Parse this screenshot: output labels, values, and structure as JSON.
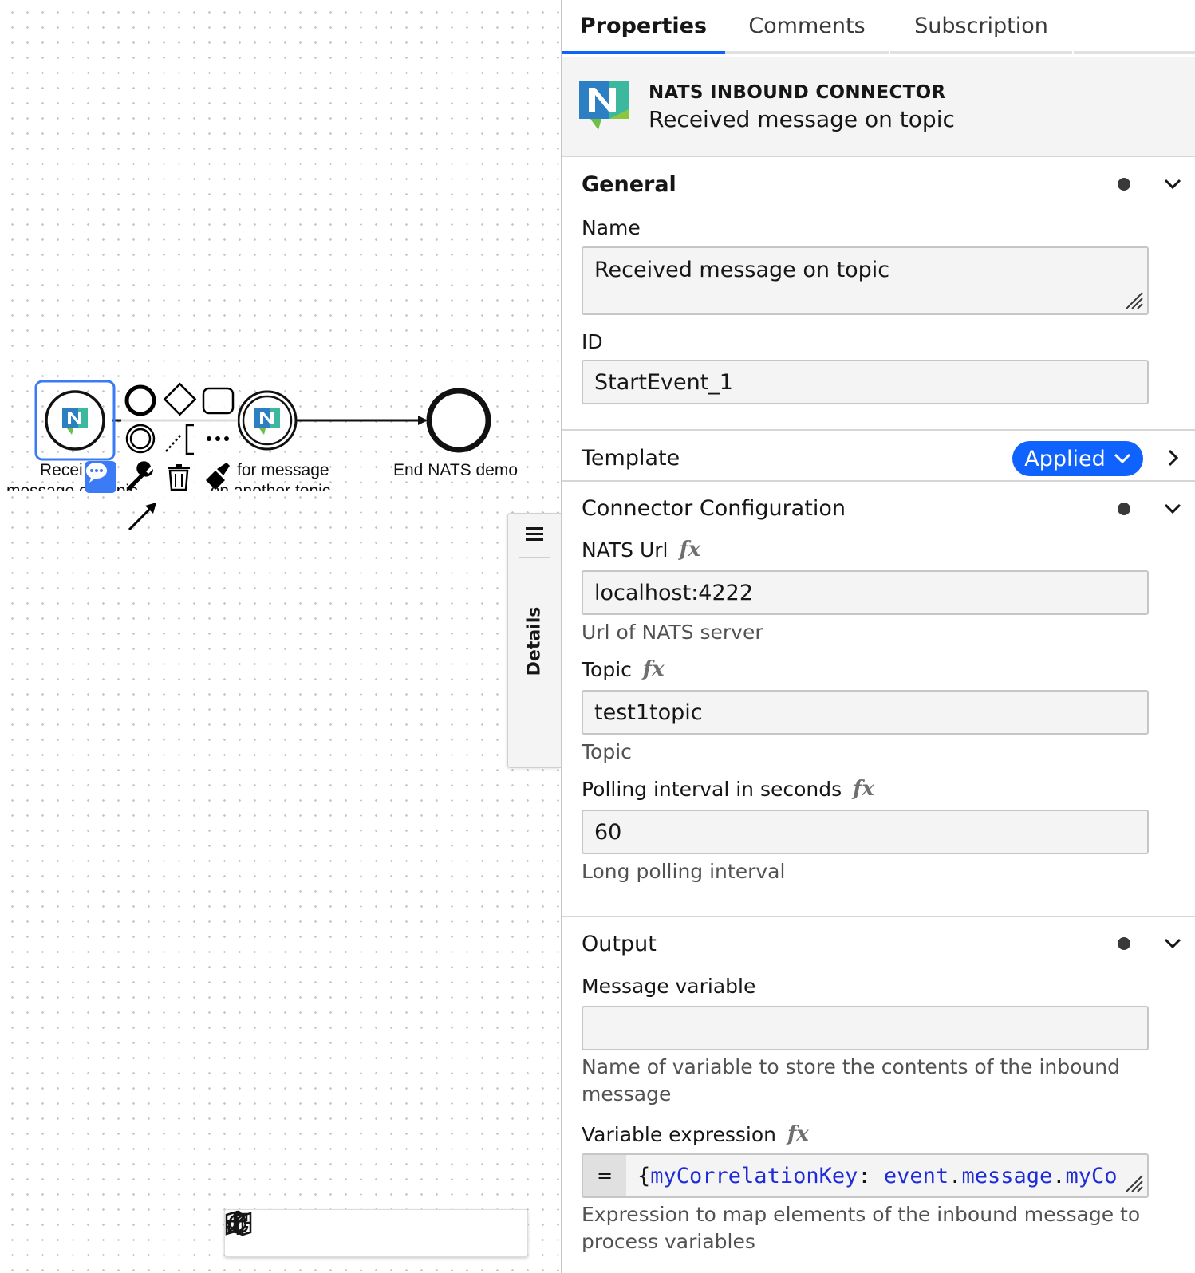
{
  "canvas": {
    "nodes": {
      "start_label_line1": "Recei",
      "start_label_line2": "message on topic",
      "intermediate_label_line1": "for message",
      "intermediate_label_line2": "on another topic",
      "end_label": "End NATS demo"
    },
    "context_pad_icons": [
      "end-event-icon",
      "gateway-icon",
      "task-icon",
      "intermediate-event-icon",
      "association-icon",
      "text-annotation-icon",
      "more-icon",
      "comment-icon",
      "wrench-icon",
      "trash-icon",
      "color-icon",
      "connect-icon"
    ],
    "details_tab": {
      "label": "Details"
    },
    "toolbar_icons": [
      "reset-position-icon",
      "fullscreen-icon",
      "minimap-icon",
      "recenter-icon",
      "zoom-out-icon",
      "zoom-in-icon"
    ]
  },
  "panel": {
    "tabs": [
      {
        "label": "Properties",
        "active": true
      },
      {
        "label": "Comments",
        "active": false
      },
      {
        "label": "Subscription",
        "active": false
      }
    ],
    "header": {
      "type": "NATS INBOUND CONNECTOR",
      "name": "Received message on topic"
    },
    "general": {
      "title": "General",
      "name_label": "Name",
      "name_value": "Received message on topic",
      "id_label": "ID",
      "id_value": "StartEvent_1"
    },
    "template": {
      "title": "Template",
      "badge": "Applied"
    },
    "connector": {
      "title": "Connector Configuration",
      "url_label": "NATS Url",
      "url_value": "localhost:4222",
      "url_hint": "Url of NATS server",
      "topic_label": "Topic",
      "topic_value": "test1topic",
      "topic_hint": "Topic",
      "poll_label": "Polling interval in seconds",
      "poll_value": "60",
      "poll_hint": "Long polling interval"
    },
    "output": {
      "title": "Output",
      "msgvar_label": "Message variable",
      "msgvar_value": "",
      "msgvar_hint": "Name of variable to store the contents of the inbound message",
      "expr_label": "Variable expression",
      "expr_eq": "=",
      "expr_brace": "{",
      "expr_key": "myCorrelationKey",
      "expr_colon": ":",
      "expr_event": "event",
      "expr_dot1": ".",
      "expr_message": "message",
      "expr_dot2": ".",
      "expr_tail": "myCo",
      "expr_hint": "Expression to map elements of the inbound message to process variables"
    },
    "fx_symbol": "fx",
    "colors": {
      "accent": "#0f62fe",
      "selection": "#3b7bf5"
    }
  }
}
